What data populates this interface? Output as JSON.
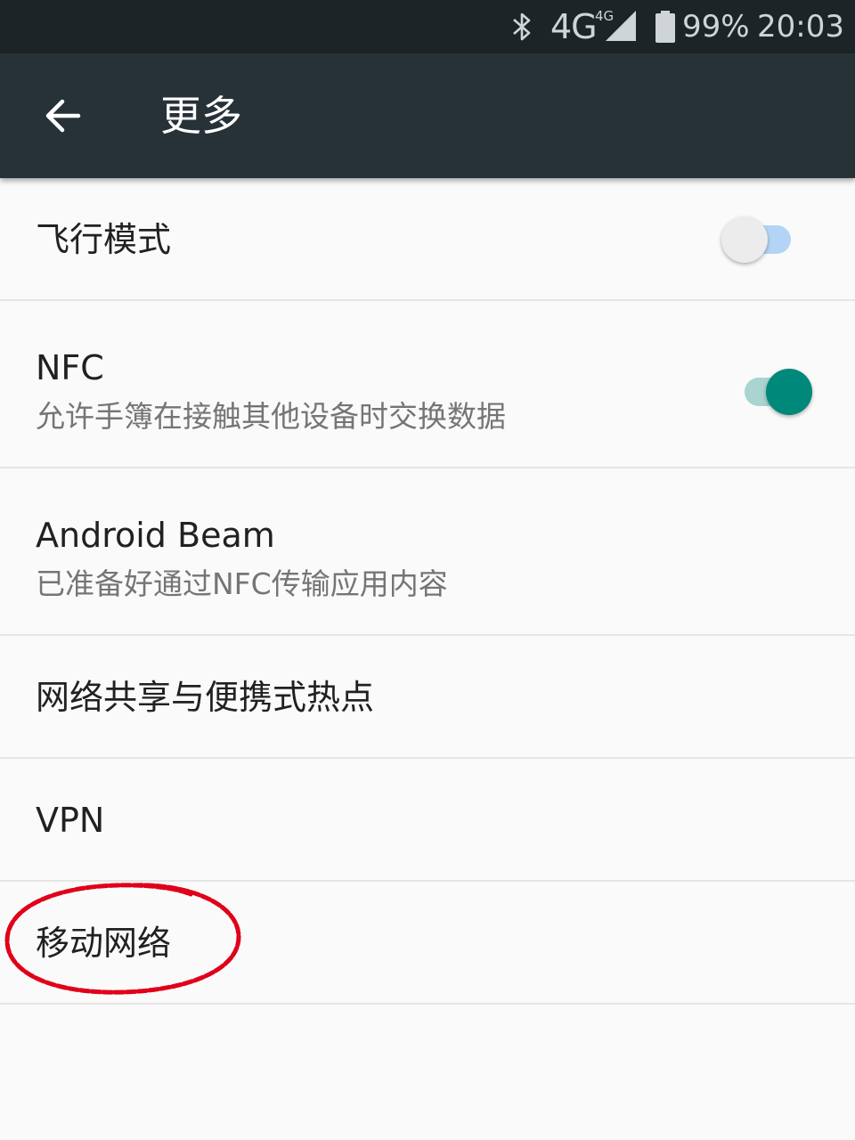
{
  "status_bar": {
    "network": "4G",
    "network_sup": "4G",
    "battery": "99%",
    "time": "20:03",
    "icons": [
      "bluetooth-icon",
      "signal-icon",
      "battery-icon"
    ]
  },
  "app_bar": {
    "title": "更多",
    "back_icon": "arrow-left-icon",
    "background": "#263238"
  },
  "settings": {
    "airplane": {
      "title": "飞行模式",
      "enabled": false
    },
    "nfc": {
      "title": "NFC",
      "summary": "允许手簿在接触其他设备时交换数据",
      "enabled": true
    },
    "beam": {
      "title": "Android Beam",
      "summary": "已准备好通过NFC传输应用内容"
    },
    "tethering": {
      "title": "网络共享与便携式热点"
    },
    "vpn": {
      "title": "VPN"
    },
    "mobile_network": {
      "title": "移动网络",
      "annotated": true
    }
  },
  "colors": {
    "accent": "#00897b",
    "annotation": "#e0001a"
  }
}
